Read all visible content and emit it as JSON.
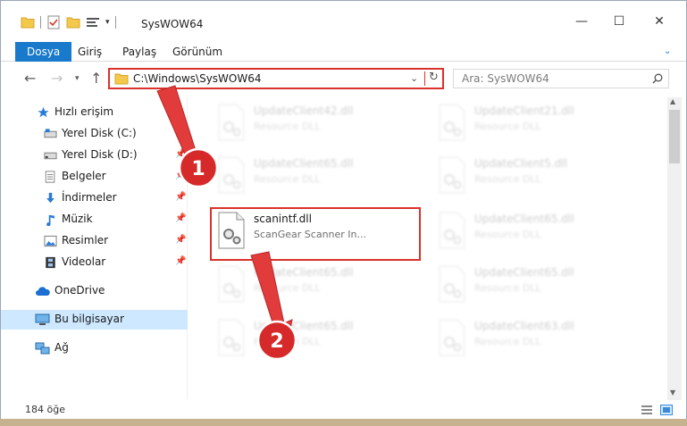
{
  "title": "SysWOW64",
  "ribbon_tabs": [
    {
      "label": "Dosya",
      "active": true
    },
    {
      "label": "Giriş",
      "active": false
    },
    {
      "label": "Paylaş",
      "active": false
    },
    {
      "label": "Görünüm",
      "active": false
    }
  ],
  "address": {
    "path": "C:\\Windows\\SysWOW64"
  },
  "search": {
    "placeholder": "Ara: SysWOW64"
  },
  "sidebar": {
    "items": [
      {
        "label": "Hızlı erişim",
        "pinned": false,
        "selected": false
      },
      {
        "label": "Yerel Disk (C:)",
        "pinned": true,
        "selected": false
      },
      {
        "label": "Yerel Disk (D:)",
        "pinned": true,
        "selected": false
      },
      {
        "label": "Belgeler",
        "pinned": true,
        "selected": false
      },
      {
        "label": "İndirmeler",
        "pinned": true,
        "selected": false
      },
      {
        "label": "Müzik",
        "pinned": true,
        "selected": false
      },
      {
        "label": "Resimler",
        "pinned": true,
        "selected": false
      },
      {
        "label": "Videolar",
        "pinned": true,
        "selected": false
      },
      {
        "label": "OneDrive",
        "pinned": false,
        "selected": false
      },
      {
        "label": "Bu bilgisayar",
        "pinned": false,
        "selected": true
      },
      {
        "label": "Ağ",
        "pinned": false,
        "selected": false
      }
    ]
  },
  "files": [
    {
      "name": "UpdateClient42.dll",
      "desc": "Resource DLL",
      "dim": true
    },
    {
      "name": "UpdateClient21.dll",
      "desc": "Resource DLL",
      "dim": true
    },
    {
      "name": "UpdateClient65.dll",
      "desc": "Resource DLL",
      "dim": true
    },
    {
      "name": "UpdateClient5.dll",
      "desc": "Resource DLL",
      "dim": true
    },
    {
      "name": "scanintf.dll",
      "desc": "ScanGear Scanner In...",
      "dim": false
    },
    {
      "name": "UpdateClient65.dll",
      "desc": "Resource DLL",
      "dim": true
    },
    {
      "name": "UpdateClient65.dll",
      "desc": "Resource DLL",
      "dim": true
    },
    {
      "name": "UpdateClient65.dll",
      "desc": "Resource DLL",
      "dim": true
    },
    {
      "name": "UpdateClient65.dll",
      "desc": "Resource DLL",
      "dim": true
    },
    {
      "name": "UpdateClient63.dll",
      "desc": "Resource DLL",
      "dim": true
    }
  ],
  "status": {
    "count": "184 öğe"
  },
  "annotations": {
    "step1": "1",
    "step2": "2"
  },
  "colors": {
    "accent": "#1979ca",
    "highlight": "#d9312c",
    "selection": "#cde8ff"
  }
}
